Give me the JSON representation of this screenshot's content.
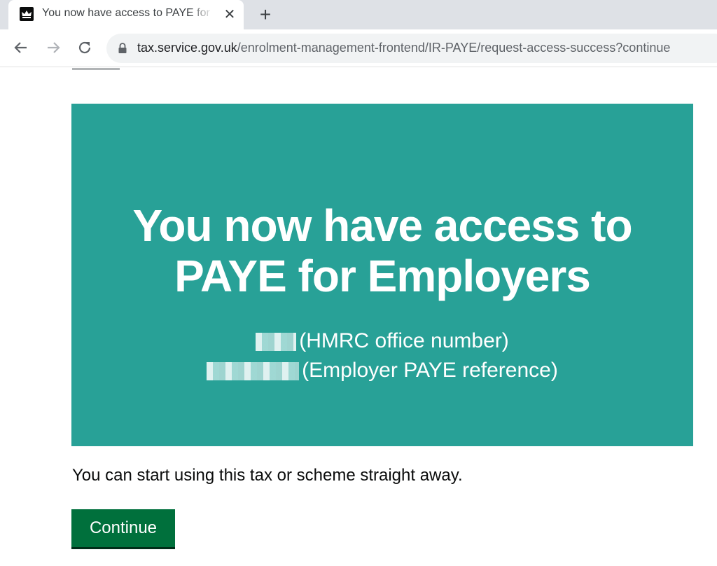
{
  "browser": {
    "tab_title": "You now have access to PAYE for Employers",
    "url_domain": "tax.service.gov.uk",
    "url_path": "/enrolment-management-frontend/IR-PAYE/request-access-success?continue"
  },
  "panel": {
    "title": "You now have access to PAYE for Employers",
    "office_number_suffix": "(HMRC office number)",
    "employer_ref_suffix": "(Employer PAYE reference)"
  },
  "main": {
    "lede": "You can start using this tax or scheme straight away.",
    "continue_label": "Continue"
  },
  "colors": {
    "panel_bg": "#28a197",
    "button_green": "#00703c"
  }
}
